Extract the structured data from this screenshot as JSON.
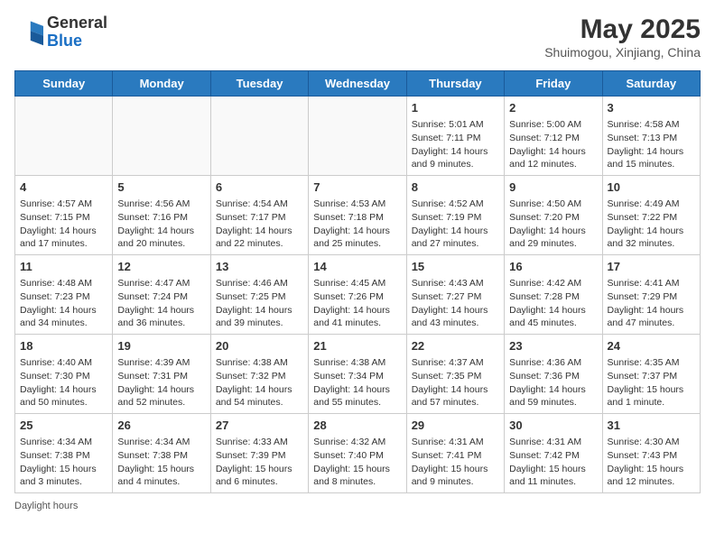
{
  "header": {
    "logo_general": "General",
    "logo_blue": "Blue",
    "month_year": "May 2025",
    "location": "Shuimogou, Xinjiang, China"
  },
  "days_of_week": [
    "Sunday",
    "Monday",
    "Tuesday",
    "Wednesday",
    "Thursday",
    "Friday",
    "Saturday"
  ],
  "weeks": [
    [
      {
        "day": "",
        "info": ""
      },
      {
        "day": "",
        "info": ""
      },
      {
        "day": "",
        "info": ""
      },
      {
        "day": "",
        "info": ""
      },
      {
        "day": "1",
        "info": "Sunrise: 5:01 AM\nSunset: 7:11 PM\nDaylight: 14 hours and 9 minutes."
      },
      {
        "day": "2",
        "info": "Sunrise: 5:00 AM\nSunset: 7:12 PM\nDaylight: 14 hours and 12 minutes."
      },
      {
        "day": "3",
        "info": "Sunrise: 4:58 AM\nSunset: 7:13 PM\nDaylight: 14 hours and 15 minutes."
      }
    ],
    [
      {
        "day": "4",
        "info": "Sunrise: 4:57 AM\nSunset: 7:15 PM\nDaylight: 14 hours and 17 minutes."
      },
      {
        "day": "5",
        "info": "Sunrise: 4:56 AM\nSunset: 7:16 PM\nDaylight: 14 hours and 20 minutes."
      },
      {
        "day": "6",
        "info": "Sunrise: 4:54 AM\nSunset: 7:17 PM\nDaylight: 14 hours and 22 minutes."
      },
      {
        "day": "7",
        "info": "Sunrise: 4:53 AM\nSunset: 7:18 PM\nDaylight: 14 hours and 25 minutes."
      },
      {
        "day": "8",
        "info": "Sunrise: 4:52 AM\nSunset: 7:19 PM\nDaylight: 14 hours and 27 minutes."
      },
      {
        "day": "9",
        "info": "Sunrise: 4:50 AM\nSunset: 7:20 PM\nDaylight: 14 hours and 29 minutes."
      },
      {
        "day": "10",
        "info": "Sunrise: 4:49 AM\nSunset: 7:22 PM\nDaylight: 14 hours and 32 minutes."
      }
    ],
    [
      {
        "day": "11",
        "info": "Sunrise: 4:48 AM\nSunset: 7:23 PM\nDaylight: 14 hours and 34 minutes."
      },
      {
        "day": "12",
        "info": "Sunrise: 4:47 AM\nSunset: 7:24 PM\nDaylight: 14 hours and 36 minutes."
      },
      {
        "day": "13",
        "info": "Sunrise: 4:46 AM\nSunset: 7:25 PM\nDaylight: 14 hours and 39 minutes."
      },
      {
        "day": "14",
        "info": "Sunrise: 4:45 AM\nSunset: 7:26 PM\nDaylight: 14 hours and 41 minutes."
      },
      {
        "day": "15",
        "info": "Sunrise: 4:43 AM\nSunset: 7:27 PM\nDaylight: 14 hours and 43 minutes."
      },
      {
        "day": "16",
        "info": "Sunrise: 4:42 AM\nSunset: 7:28 PM\nDaylight: 14 hours and 45 minutes."
      },
      {
        "day": "17",
        "info": "Sunrise: 4:41 AM\nSunset: 7:29 PM\nDaylight: 14 hours and 47 minutes."
      }
    ],
    [
      {
        "day": "18",
        "info": "Sunrise: 4:40 AM\nSunset: 7:30 PM\nDaylight: 14 hours and 50 minutes."
      },
      {
        "day": "19",
        "info": "Sunrise: 4:39 AM\nSunset: 7:31 PM\nDaylight: 14 hours and 52 minutes."
      },
      {
        "day": "20",
        "info": "Sunrise: 4:38 AM\nSunset: 7:32 PM\nDaylight: 14 hours and 54 minutes."
      },
      {
        "day": "21",
        "info": "Sunrise: 4:38 AM\nSunset: 7:34 PM\nDaylight: 14 hours and 55 minutes."
      },
      {
        "day": "22",
        "info": "Sunrise: 4:37 AM\nSunset: 7:35 PM\nDaylight: 14 hours and 57 minutes."
      },
      {
        "day": "23",
        "info": "Sunrise: 4:36 AM\nSunset: 7:36 PM\nDaylight: 14 hours and 59 minutes."
      },
      {
        "day": "24",
        "info": "Sunrise: 4:35 AM\nSunset: 7:37 PM\nDaylight: 15 hours and 1 minute."
      }
    ],
    [
      {
        "day": "25",
        "info": "Sunrise: 4:34 AM\nSunset: 7:38 PM\nDaylight: 15 hours and 3 minutes."
      },
      {
        "day": "26",
        "info": "Sunrise: 4:34 AM\nSunset: 7:38 PM\nDaylight: 15 hours and 4 minutes."
      },
      {
        "day": "27",
        "info": "Sunrise: 4:33 AM\nSunset: 7:39 PM\nDaylight: 15 hours and 6 minutes."
      },
      {
        "day": "28",
        "info": "Sunrise: 4:32 AM\nSunset: 7:40 PM\nDaylight: 15 hours and 8 minutes."
      },
      {
        "day": "29",
        "info": "Sunrise: 4:31 AM\nSunset: 7:41 PM\nDaylight: 15 hours and 9 minutes."
      },
      {
        "day": "30",
        "info": "Sunrise: 4:31 AM\nSunset: 7:42 PM\nDaylight: 15 hours and 11 minutes."
      },
      {
        "day": "31",
        "info": "Sunrise: 4:30 AM\nSunset: 7:43 PM\nDaylight: 15 hours and 12 minutes."
      }
    ]
  ],
  "footer": {
    "note": "Daylight hours"
  }
}
